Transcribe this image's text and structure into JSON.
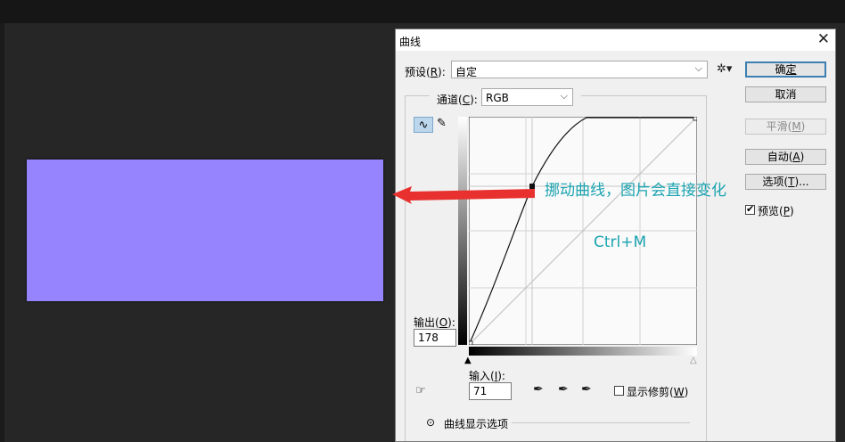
{
  "dialog": {
    "title": "曲线",
    "close_icon": "close-icon",
    "preset": {
      "label_prefix": "预设(",
      "label_key": "R",
      "label_suffix": "):",
      "value": "自定"
    },
    "channel": {
      "label_prefix": "通道(",
      "label_key": "C",
      "label_suffix": "):",
      "value": "RGB"
    },
    "buttons": {
      "ok": {
        "prefix": "确",
        "key": "定",
        "suffix": ""
      },
      "cancel": "取消",
      "smooth": {
        "prefix": "平滑(",
        "key": "M",
        "suffix": ")"
      },
      "auto": {
        "prefix": "自动(",
        "key": "A",
        "suffix": ")"
      },
      "options": {
        "prefix": "选项(",
        "key": "T",
        "suffix": ")..."
      }
    },
    "preview": {
      "prefix": "预览(",
      "key": "P",
      "suffix": ")",
      "checked": true
    },
    "output": {
      "prefix": "输出(",
      "key": "O",
      "suffix": "):",
      "value": "178"
    },
    "input": {
      "prefix": "输入(",
      "key": "I",
      "suffix": "):",
      "value": "71"
    },
    "show_clipping": {
      "prefix": "显示修剪(",
      "key": "W",
      "suffix": ")",
      "checked": false
    },
    "curve_display_options": "曲线显示选项"
  },
  "annotations": {
    "main_text": "挪动曲线，图片会直接变化",
    "shortcut": "Ctrl+M",
    "color": "#1aa3b0",
    "arrow_color": "#e8312f"
  },
  "document": {
    "fill_color": "#9684fe"
  },
  "curve_point": {
    "input": 71,
    "output": 178
  }
}
